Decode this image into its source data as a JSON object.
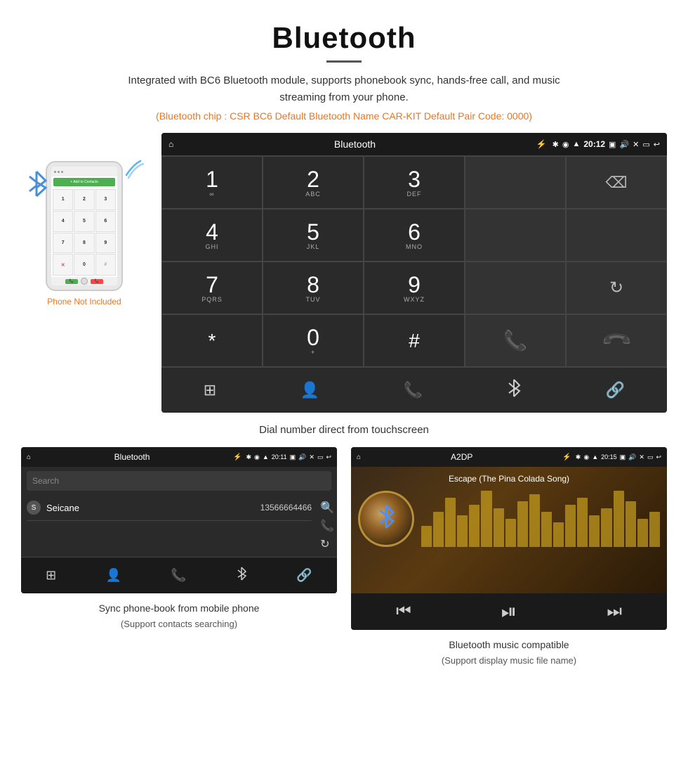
{
  "header": {
    "title": "Bluetooth",
    "description": "Integrated with BC6 Bluetooth module, supports phonebook sync, hands-free call, and music streaming from your phone.",
    "specs": "(Bluetooth chip : CSR BC6    Default Bluetooth Name CAR-KIT    Default Pair Code: 0000)"
  },
  "main_screen": {
    "status_bar": {
      "home_icon": "⌂",
      "title": "Bluetooth",
      "usb_icon": "⚡",
      "time": "20:12",
      "bt_icon": "✱",
      "location_icon": "◉",
      "signal_icon": "▲",
      "camera_icon": "📷",
      "volume_icon": "🔊",
      "close_icon": "✕",
      "rect_icon": "▬",
      "back_icon": "↩"
    },
    "keypad": {
      "keys": [
        {
          "number": "1",
          "letters": "∞"
        },
        {
          "number": "2",
          "letters": "ABC"
        },
        {
          "number": "3",
          "letters": "DEF"
        },
        {
          "number": "",
          "letters": "",
          "type": "empty"
        },
        {
          "number": "",
          "letters": "",
          "type": "backspace"
        },
        {
          "number": "4",
          "letters": "GHI"
        },
        {
          "number": "5",
          "letters": "JKL"
        },
        {
          "number": "6",
          "letters": "MNO"
        },
        {
          "number": "",
          "letters": "",
          "type": "empty"
        },
        {
          "number": "",
          "letters": "",
          "type": "empty"
        },
        {
          "number": "7",
          "letters": "PQRS"
        },
        {
          "number": "8",
          "letters": "TUV"
        },
        {
          "number": "9",
          "letters": "WXYZ"
        },
        {
          "number": "",
          "letters": "",
          "type": "empty"
        },
        {
          "number": "",
          "letters": "",
          "type": "reload"
        },
        {
          "number": "*",
          "letters": "",
          "type": "symbol"
        },
        {
          "number": "0",
          "letters": "+",
          "type": "zero"
        },
        {
          "number": "#",
          "letters": "",
          "type": "symbol"
        },
        {
          "number": "",
          "letters": "",
          "type": "call-green"
        },
        {
          "number": "",
          "letters": "",
          "type": "call-red"
        }
      ]
    },
    "action_bar_icons": [
      "⊞",
      "👤",
      "📞",
      "✱",
      "🔗"
    ]
  },
  "dial_caption": "Dial number direct from touchscreen",
  "phone": {
    "not_included": "Phone Not Included",
    "keys": [
      "1",
      "2",
      "3",
      "4",
      "5",
      "6",
      "7",
      "8",
      "9",
      "*",
      "0",
      "#"
    ]
  },
  "bottom_left": {
    "status_title": "Bluetooth",
    "time": "20:11",
    "search_placeholder": "Search",
    "contact_letter": "S",
    "contact_name": "Seicane",
    "contact_number": "13566664466",
    "caption": "Sync phone-book from mobile phone",
    "caption_sub": "(Support contacts searching)"
  },
  "bottom_right": {
    "status_title": "A2DP",
    "time": "20:15",
    "song_title": "Escape (The Pina Colada Song)",
    "caption": "Bluetooth music compatible",
    "caption_sub": "(Support display music file name)"
  },
  "viz_bars": [
    30,
    50,
    70,
    45,
    60,
    80,
    55,
    40,
    65,
    75,
    50,
    35,
    60,
    70,
    45,
    55,
    80,
    65,
    40,
    50
  ]
}
